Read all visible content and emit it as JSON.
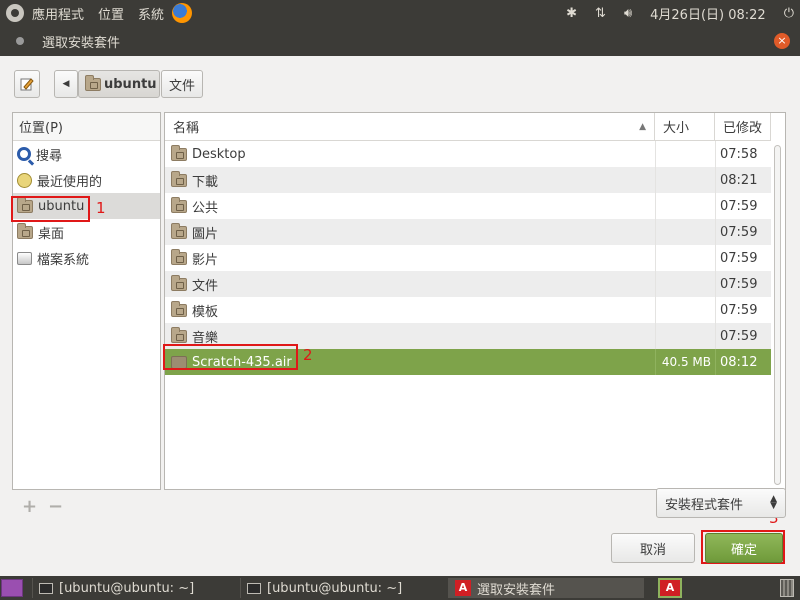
{
  "top_panel": {
    "menus": [
      "應用程式",
      "位置",
      "系統"
    ],
    "datetime": "4月26日(日) 08:22"
  },
  "dialog": {
    "title": "選取安裝套件",
    "close_glyph": "×",
    "path": [
      "ubuntu",
      "文件"
    ],
    "places_header": "位置(P)",
    "places": [
      {
        "label": "搜尋",
        "icon": "search-icon"
      },
      {
        "label": "最近使用的",
        "icon": "recent-icon"
      },
      {
        "label": "ubuntu",
        "icon": "home-folder-icon",
        "selected": true
      },
      {
        "label": "桌面",
        "icon": "desktop-folder-icon"
      },
      {
        "label": "檔案系統",
        "icon": "drive-icon"
      }
    ],
    "columns": {
      "name": "名稱",
      "size": "大小",
      "modified": "已修改"
    },
    "files": [
      {
        "name": "Desktop",
        "size": "",
        "modified": "07:58"
      },
      {
        "name": "下載",
        "size": "",
        "modified": "08:21"
      },
      {
        "name": "公共",
        "size": "",
        "modified": "07:59"
      },
      {
        "name": "圖片",
        "size": "",
        "modified": "07:59"
      },
      {
        "name": "影片",
        "size": "",
        "modified": "07:59"
      },
      {
        "name": "文件",
        "size": "",
        "modified": "07:59"
      },
      {
        "name": "模板",
        "size": "",
        "modified": "07:59"
      },
      {
        "name": "音樂",
        "size": "",
        "modified": "07:59"
      },
      {
        "name": "Scratch-435.air",
        "size": "40.5 MB",
        "modified": "08:12",
        "selected": true
      }
    ],
    "filter": "安裝程式套件",
    "cancel_label": "取消",
    "ok_label": "確定",
    "add_glyph": "+",
    "remove_glyph": "−"
  },
  "annotations": [
    "1",
    "2",
    "3"
  ],
  "taskbar": {
    "tasks": [
      "[ubuntu@ubuntu: ~]",
      "[ubuntu@ubuntu: ~]",
      "選取安裝套件"
    ]
  },
  "colors": {
    "selection": "#7ea34a",
    "annotation": "#e01818",
    "panel": "#3c3b37"
  }
}
